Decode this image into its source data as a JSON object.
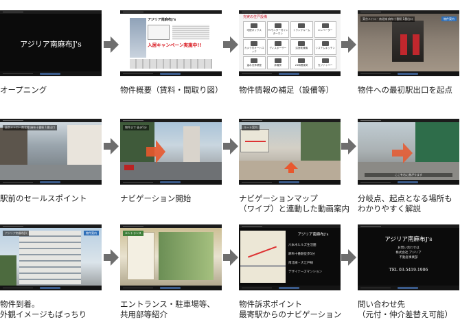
{
  "captions": [
    "オープニング",
    "物件概要（賃料・間取り図）",
    "物件情報の補足（設備等）",
    "物件への最初駅出口を起点",
    "駅前のセールスポイント",
    "ナビゲーション開始",
    "ナビゲーションマップ\n（ワイプ）と連動した動画案内",
    "分岐点、起点となる場所も\nわかりやすく解説",
    "物件到着。\n外観イメージもばっちり",
    "エントランス・駐車場等、\n共用部等紹介",
    "物件訴求ポイント\n最寄駅からのナビゲーション",
    "問い合わせ先\n（元付・仲介差替え可能）"
  ],
  "screens": {
    "opening_title": "アジリア南麻布J's",
    "overview_name": "アジリア南麻布J's",
    "overview_campaign": "入居キャンペーン実施中!!",
    "equipment_heading": "充実の住戸設備",
    "equipment_items": [
      "宅配ボックス",
      "TVモニター付インターホン",
      "トランクルーム",
      "エレベーター",
      "カメラ付オートロック",
      "ディスポーザー",
      "浴室乾燥機",
      "システムキッチン",
      "温水洗浄便座",
      "床暖房",
      "24時間換気",
      "光ファイバー"
    ],
    "station_banner": "東京メトロ・南北線 麻布十番駅 1番出口",
    "sales_banner": "東京メトロ・南北線 麻布十番駅 1番出口",
    "nav_banner": "物件まで 徒歩5分",
    "map_banner": "ルート案内",
    "branch_sub": "ここを右に曲がります",
    "arrival_name": "アジリア南麻布J's",
    "entrance_label": "エントランス",
    "appeal_name": "アジリア南麻布J's",
    "appeal_lines": [
      "六本木ヒルズ生活圏",
      "麻布十番駅徒歩5分",
      "南北線・大江戸線",
      "デザイナーズマンション"
    ],
    "contact_name": "アジリア南麻布J's",
    "contact_lines": [
      "お問い合わせは",
      "株式会社 アジリア",
      "不動産事業部"
    ],
    "contact_tel": "TEL 03-5419-1906",
    "tag_label": "物件案内"
  },
  "colors": {
    "arrow": "#6e6e6e",
    "frame_bg": "#0b0b0b",
    "caption": "#222222",
    "nav_arrow": "#e8582e",
    "campaign": "#d8141c"
  },
  "icons": [
    "arrow-right-icon"
  ]
}
